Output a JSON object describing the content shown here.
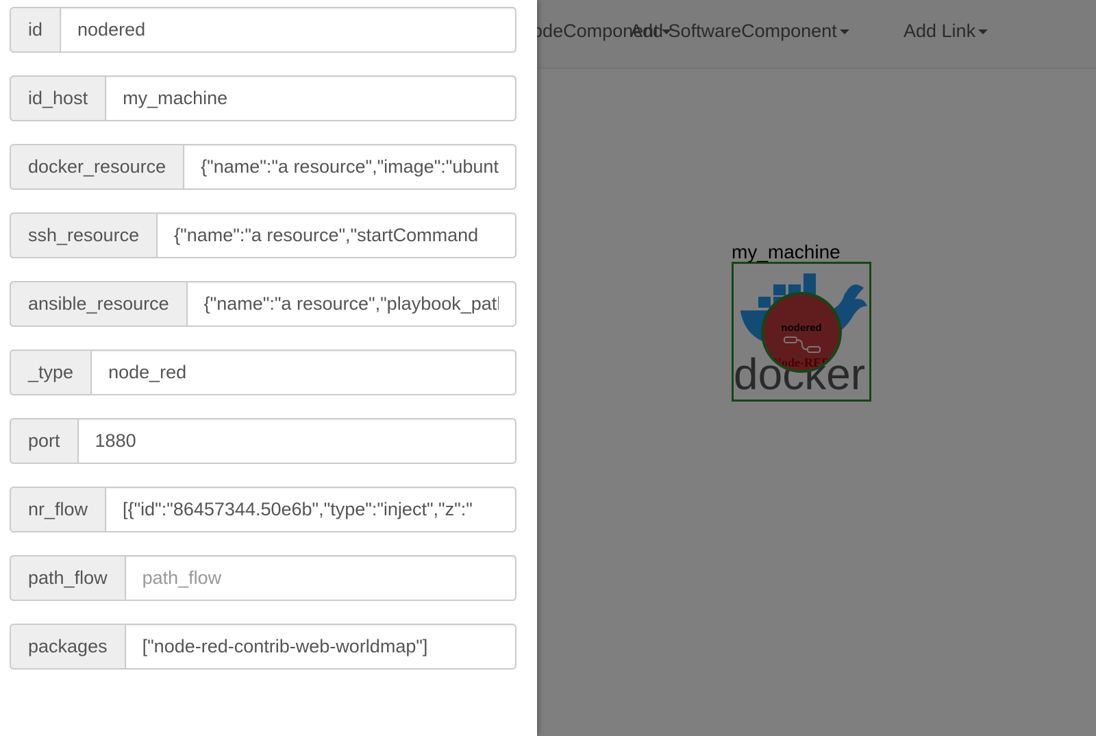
{
  "navbar": {
    "items": [
      {
        "label": "Add NodeComponent"
      },
      {
        "label": "Add SoftwareComponent"
      },
      {
        "label": "Add Link"
      }
    ]
  },
  "canvas": {
    "host_label": "my_machine",
    "node_label": "nodered",
    "host_logo_text": "docker",
    "node_logo_text": "Node-RED"
  },
  "form": {
    "fields": [
      {
        "label": "id",
        "value": "nodered",
        "placeholder": ""
      },
      {
        "label": "id_host",
        "value": "my_machine",
        "placeholder": ""
      },
      {
        "label": "docker_resource",
        "value": "{\"name\":\"a resource\",\"image\":\"ubuntu",
        "placeholder": ""
      },
      {
        "label": "ssh_resource",
        "value": "{\"name\":\"a resource\",\"startCommand",
        "placeholder": ""
      },
      {
        "label": "ansible_resource",
        "value": "{\"name\":\"a resource\",\"playbook_path",
        "placeholder": ""
      },
      {
        "label": "_type",
        "value": "node_red",
        "placeholder": ""
      },
      {
        "label": "port",
        "value": "1880",
        "placeholder": ""
      },
      {
        "label": "nr_flow",
        "value": "[{\"id\":\"86457344.50e6b\",\"type\":\"inject\",\"z\":\"",
        "placeholder": ""
      },
      {
        "label": "path_flow",
        "value": "",
        "placeholder": "path_flow"
      },
      {
        "label": "packages",
        "value": "[\"node-red-contrib-web-worldmap\"]",
        "placeholder": ""
      }
    ]
  },
  "colors": {
    "host_border": "#2e8b2e",
    "node_fill": "#c23a3a",
    "docker_blue": "#2496ed",
    "backdrop": "rgba(0,0,0,0.5)"
  }
}
